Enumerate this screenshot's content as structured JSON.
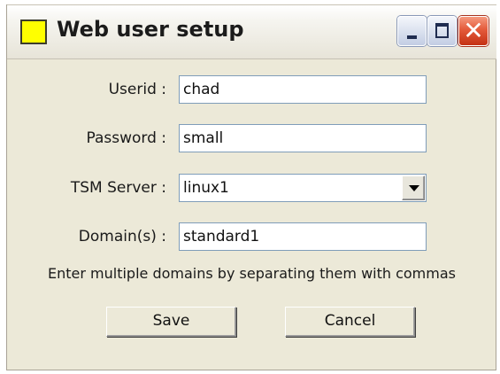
{
  "window": {
    "title": "Web user setup",
    "icon": "yellow-square-icon",
    "controls": [
      "minimize-icon",
      "maximize-icon",
      "close-icon"
    ]
  },
  "form": {
    "userid": {
      "label": "Userid :",
      "value": "chad"
    },
    "password": {
      "label": "Password :",
      "value": "small"
    },
    "tsm_server": {
      "label": "TSM Server :",
      "value": "linux1"
    },
    "domains": {
      "label": "Domain(s) :",
      "value": "standard1"
    },
    "hint": "Enter multiple domains by separating them with commas"
  },
  "buttons": {
    "save": "Save",
    "cancel": "Cancel"
  },
  "colors": {
    "window_bg": "#ece9d8",
    "title_icon": "#ffff00",
    "close_button": "#e45a3a",
    "input_border": "#7f9db9"
  }
}
